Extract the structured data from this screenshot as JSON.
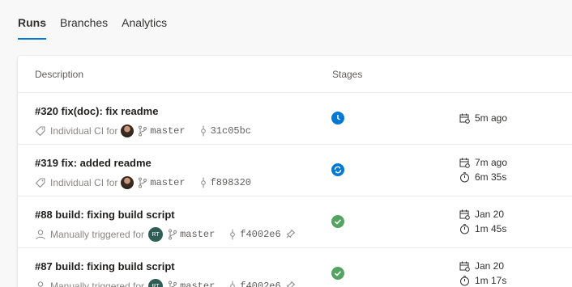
{
  "tabs": [
    {
      "label": "Runs",
      "active": true
    },
    {
      "label": "Branches",
      "active": false
    },
    {
      "label": "Analytics",
      "active": false
    }
  ],
  "table": {
    "columns": {
      "description": "Description",
      "stages": "Stages"
    }
  },
  "runs": [
    {
      "title": "#320 fix(doc): fix readme",
      "trigger_text": "Individual CI for",
      "trigger_icon": "tag-icon",
      "avatar": "photo",
      "branch": "master",
      "commit": "31c05bc",
      "status": "queued",
      "status_color": "#0078d4",
      "date": "5m ago",
      "duration": ""
    },
    {
      "title": "#319 fix: added readme",
      "trigger_text": "Individual CI for",
      "trigger_icon": "tag-icon",
      "avatar": "photo",
      "branch": "master",
      "commit": "f898320",
      "status": "running",
      "status_color": "#0078d4",
      "date": "7m ago",
      "duration": "6m 35s"
    },
    {
      "title": "#88 build: fixing build script",
      "trigger_text": "Manually triggered for",
      "trigger_icon": "person-icon",
      "avatar": "initials",
      "avatar_initials": "RT",
      "branch": "master",
      "commit": "f4002e6",
      "pinned": true,
      "status": "succeeded",
      "status_color": "#55a362",
      "date": "Jan 20",
      "duration": "1m 45s"
    },
    {
      "title": "#87 build: fixing build script",
      "trigger_text": "Manually triggered for",
      "trigger_icon": "person-icon",
      "avatar": "initials",
      "avatar_initials": "RT",
      "branch": "master",
      "commit": "f4002e6",
      "pinned": true,
      "status": "succeeded",
      "status_color": "#55a362",
      "date": "Jan 20",
      "duration": "1m 17s"
    }
  ]
}
